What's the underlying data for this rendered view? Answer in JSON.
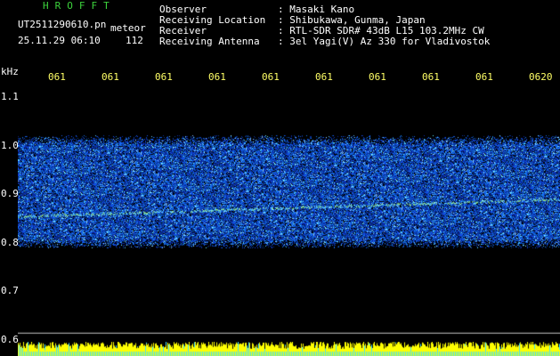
{
  "app": {
    "brand": "HROFFT",
    "filename": "UT2511290610.pn",
    "mode": "meteor",
    "datetime": "25.11.29 06:10",
    "count": "112"
  },
  "info": {
    "labels": [
      "Observer",
      "Receiving Location",
      "Receiver",
      "Receiving Antenna"
    ],
    "values": [
      ": Masaki Kano",
      ": Shibukawa, Gunma, Japan",
      ": RTL-SDR SDR# 43dB L15 103.2MHz CW",
      ": 3el Yagi(V) Az 330 for Vladivostok"
    ]
  },
  "chart_data": {
    "type": "heatmap",
    "title": "",
    "xlabel": "",
    "ylabel": "kHz",
    "x_ticks": [
      "061",
      "061",
      "061",
      "061",
      "061",
      "061",
      "061",
      "061",
      "061",
      "0620"
    ],
    "y_ticks": [
      "1.1",
      "1.0",
      "0.9",
      "0.8",
      "0.7",
      "0.6"
    ],
    "ylim": [
      0.6,
      1.12
    ],
    "noise_band_khz": [
      0.79,
      1.02
    ],
    "carrier_khz_start": 0.855,
    "carrier_khz_end": 0.89,
    "colors": {
      "background": "#000000",
      "noise_low": "#0a1a6e",
      "noise_mid": "#1f5cff",
      "noise_high": "#5fd0ff",
      "carrier": "#9af08a",
      "amplitude_bar": "#ffff00",
      "amplitude_alt": "#40e0ff",
      "baseline": "#c8c8c8"
    }
  }
}
